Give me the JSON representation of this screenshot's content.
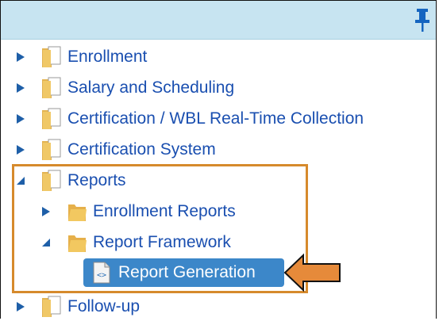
{
  "tree": {
    "items": [
      {
        "label": "Enrollment"
      },
      {
        "label": "Salary and Scheduling"
      },
      {
        "label": "Certification / WBL Real-Time Collection"
      },
      {
        "label": "Certification System"
      },
      {
        "label": "Reports"
      },
      {
        "label": "Enrollment Reports"
      },
      {
        "label": "Report Framework"
      },
      {
        "label": "Report Generation"
      },
      {
        "label": "Follow-up"
      }
    ]
  },
  "colors": {
    "header_bg": "#c7e4f1",
    "link": "#1a4fb0",
    "selected_bg": "#3c87c9",
    "highlight": "#d68a2c"
  },
  "icons": [
    "pin-icon",
    "expand-arrow-icon",
    "collapse-arrow-icon",
    "folder-icon",
    "document-icon",
    "callout-arrow-icon"
  ]
}
